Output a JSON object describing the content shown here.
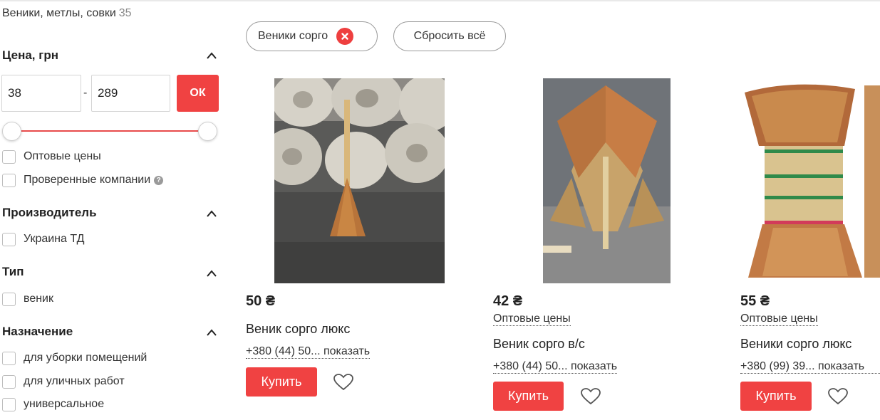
{
  "category": {
    "title": "Веники, метлы, совки",
    "count": "35"
  },
  "filters": {
    "price": {
      "title": "Цена, грн",
      "min_value": "38",
      "max_value": "289",
      "separator": "-",
      "ok_label": "ОК"
    },
    "flags": [
      {
        "label": "Оптовые цены",
        "checked": false
      },
      {
        "label": "Проверенные компании",
        "checked": false,
        "help": "?"
      }
    ],
    "manufacturer": {
      "title": "Производитель",
      "options": [
        {
          "label": "Украина ТД",
          "checked": false
        }
      ]
    },
    "type": {
      "title": "Тип",
      "options": [
        {
          "label": "веник",
          "checked": false
        }
      ]
    },
    "purpose": {
      "title": "Назначение",
      "options": [
        {
          "label": "для уборки помещений",
          "checked": false
        },
        {
          "label": "для уличных работ",
          "checked": false
        },
        {
          "label": "универсальное",
          "checked": false
        }
      ]
    }
  },
  "active_filters": {
    "chips": [
      {
        "label": "Веники сорго"
      }
    ],
    "reset_label": "Сбросить всё"
  },
  "products": [
    {
      "price": "50 ₴",
      "name": "Веник сорго люкс",
      "phone": "+380 (44) 50... показать",
      "buy_label": "Купить"
    },
    {
      "price": "42 ₴",
      "wholesale": "Оптовые цены",
      "name": "Веник сорго в/с",
      "phone": "+380 (44) 50... показать",
      "buy_label": "Купить"
    },
    {
      "price": "55 ₴",
      "wholesale": "Оптовые цены",
      "name": "Веники сорго люкс",
      "phone": "+380 (99) 39... показать",
      "buy_label": "Купить"
    }
  ],
  "colors": {
    "accent": "#f04242",
    "slider": "#e84b4b",
    "chip_close": "#ee3f3f"
  },
  "icons": [
    "chevron-up-icon",
    "help-icon",
    "close-circle-icon",
    "heart-icon"
  ]
}
